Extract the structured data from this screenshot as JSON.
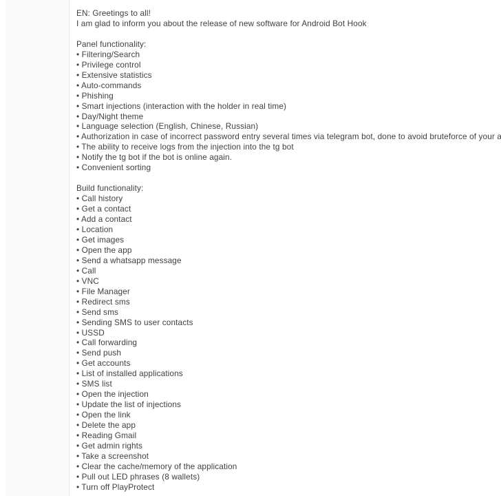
{
  "document": {
    "kind": "telegram-channel-post",
    "background_color": "#ffffff",
    "sidebar_color": "#fafafa",
    "sidebar_border_color": "#e7e7e7",
    "text_color": "#3f3f40",
    "bullet_glyph": "•"
  },
  "post": {
    "greeting": "EN: Greetings to all!",
    "intro": "I am glad to inform you about the release of new software for Android Bot Hook",
    "sections": [
      {
        "heading": "Panel functionality:",
        "items": [
          "Filtering/Search",
          "Privilege control",
          "Extensive statistics",
          "Auto-commands",
          "Phishing",
          "Smart injections (interaction with the holder in real time)",
          "Day/Night theme",
          "Language selection (English, Chinese, Russian)",
          "Authorization in case of incorrect password entry several times via telegram bot, done to avoid bruteforce of your account.",
          "The ability to receive logs from the injection into the tg bot",
          "Notify the tg bot if the bot is online again.",
          "Convenient sorting"
        ]
      },
      {
        "heading": "Build functionality:",
        "items": [
          "Call history",
          "Get a contact",
          "Add a contact",
          "Location",
          "Get images",
          "Open the app",
          "Send a whatsapp message",
          "Call",
          "VNC",
          "File Manager",
          "Redirect sms",
          "Send sms",
          "Sending SMS to user contacts",
          "USSD",
          "Call forwarding",
          "Send push",
          "Get accounts",
          "List of installed applications",
          "SMS list",
          "Open the injection",
          "Update the list of injections",
          "Open the link",
          "Delete the app",
          "Reading Gmail",
          "Get admin rights",
          "Take a screenshot",
          "Clear the cache/memory of the application",
          "Pull out LED phrases (8 wallets)",
          "Turn off PlayProtect"
        ]
      }
    ]
  }
}
